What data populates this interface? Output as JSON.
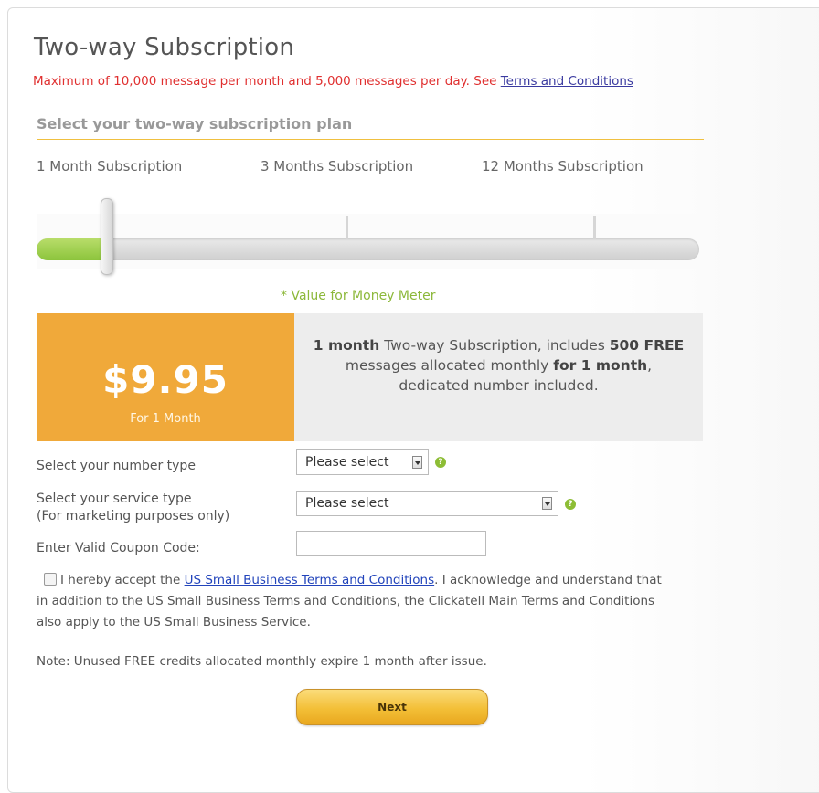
{
  "header": {
    "title": "Two-way Subscription",
    "limits_text": "Maximum of 10,000 message per month and 5,000 messages per day. See ",
    "limits_link": "Terms and Conditions"
  },
  "plan_selector": {
    "section_title": "Select your two-way subscription plan",
    "options": [
      "1 Month Subscription",
      "3 Months Subscription",
      "12 Months Subscription"
    ],
    "selected_index": 0,
    "meter_label": "* Value for Money Meter"
  },
  "price": {
    "amount": "$9.95",
    "period": "For 1 Month"
  },
  "description": {
    "part1_bold": "1 month",
    "part2": " Two-way Subscription, includes ",
    "part3_bold": "500 FREE",
    "part4": " messages allocated monthly ",
    "part5_bold": "for 1 month",
    "part6": ", dedicated number included."
  },
  "form": {
    "number_type_label": "Select your number type",
    "number_type_value": "Please select",
    "service_type_label_line1": "Select your service type",
    "service_type_label_line2": "(For marketing purposes only)",
    "service_type_value": "Please select",
    "coupon_label": "Enter Valid Coupon Code:",
    "coupon_value": "",
    "help_glyph": "?"
  },
  "terms": {
    "prefix": "I hereby accept the ",
    "link": "US Small Business Terms and Conditions",
    "suffix": ". I acknowledge and understand that in addition to the US Small Business Terms and Conditions, the Clickatell Main Terms and Conditions also apply to the US Small Business Service."
  },
  "note": "Note: Unused FREE credits allocated monthly expire 1 month after issue.",
  "next_button": "Next",
  "colors": {
    "accent_orange": "#f0a93a",
    "slider_green": "#8cc43c",
    "warning_red": "#e03030",
    "help_green": "#8dbd35"
  }
}
